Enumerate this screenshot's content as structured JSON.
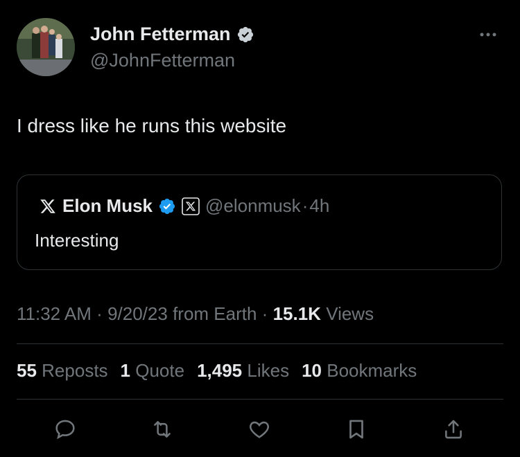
{
  "author": {
    "name": "John Fetterman",
    "handle": "@JohnFetterman",
    "verified": true,
    "verified_color": "#c9d0d6"
  },
  "post": {
    "text": "I dress like he runs this website"
  },
  "quote": {
    "name": "Elon Musk",
    "verified_color": "#1d9bf0",
    "handle": "@elonmusk",
    "separator": "·",
    "age": "4h",
    "text": "Interesting"
  },
  "meta": {
    "time": "11:32 AM",
    "sep1": "·",
    "date": "9/20/23",
    "location": "from Earth",
    "sep2": "·",
    "views_count": "15.1K",
    "views_label": "Views"
  },
  "stats": {
    "reposts_count": "55",
    "reposts_label": "Reposts",
    "quotes_count": "1",
    "quotes_label": "Quote",
    "likes_count": "1,495",
    "likes_label": "Likes",
    "bookmarks_count": "10",
    "bookmarks_label": "Bookmarks"
  },
  "actions": [
    "reply-icon",
    "repost-icon",
    "like-icon",
    "bookmark-icon",
    "share-icon"
  ],
  "colors": {
    "background": "#000000",
    "text": "#e7e9ea",
    "muted": "#71767b",
    "border": "#2f3336"
  }
}
